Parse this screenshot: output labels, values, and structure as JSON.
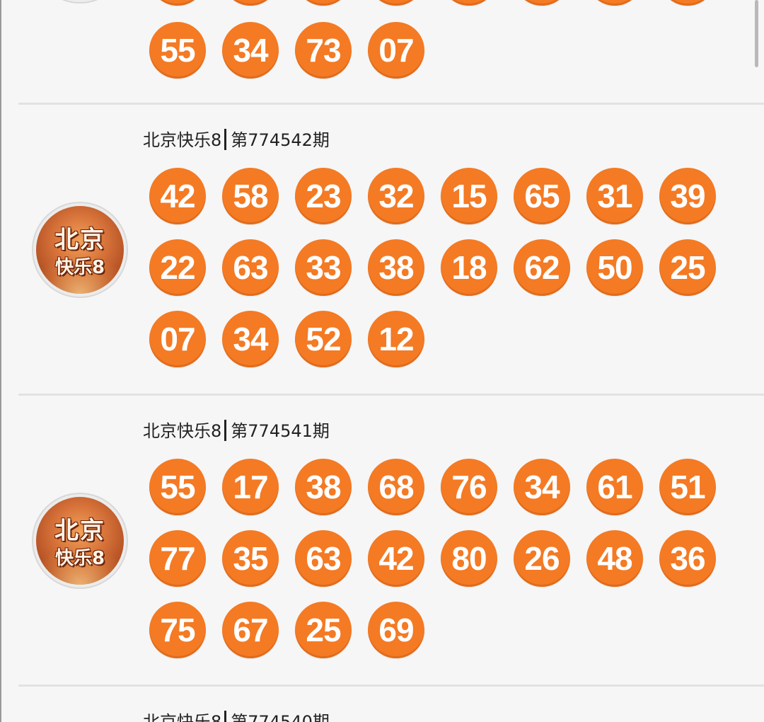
{
  "lottery_name": "北京快乐8",
  "avatar": {
    "line1": "北京",
    "line2": "快乐8"
  },
  "draws": [
    {
      "name": "北京快乐8",
      "period": "",
      "numbers": [
        "55",
        "34",
        "73",
        "07"
      ],
      "partial": true
    },
    {
      "name": "北京快乐8",
      "period": "第774542期",
      "numbers": [
        "42",
        "58",
        "23",
        "32",
        "15",
        "65",
        "31",
        "39",
        "22",
        "63",
        "33",
        "38",
        "18",
        "62",
        "50",
        "25",
        "07",
        "34",
        "52",
        "12"
      ]
    },
    {
      "name": "北京快乐8",
      "period": "第774541期",
      "numbers": [
        "55",
        "17",
        "38",
        "68",
        "76",
        "34",
        "61",
        "51",
        "77",
        "35",
        "63",
        "42",
        "80",
        "26",
        "48",
        "36",
        "75",
        "67",
        "25",
        "69"
      ]
    },
    {
      "name": "北京快乐8",
      "period": "第774540期",
      "numbers": []
    }
  ],
  "colors": {
    "ball": "#f47a24",
    "background": "#f6f6f6"
  }
}
